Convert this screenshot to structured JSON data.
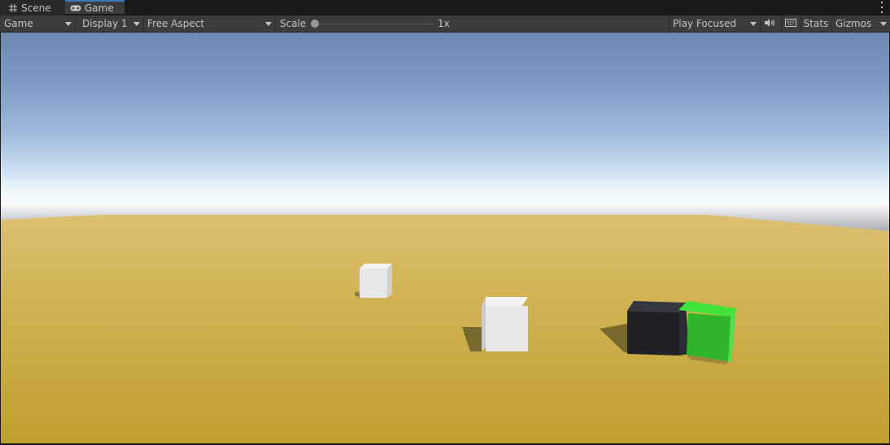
{
  "tabs": [
    {
      "label": "Scene",
      "icon": "grid-icon"
    },
    {
      "label": "Game",
      "icon": "gamepad-icon"
    }
  ],
  "toolbar": {
    "view_select": "Game",
    "display_select": "Display 1",
    "aspect_select": "Free Aspect",
    "scale_label": "Scale",
    "scale_value": "1x",
    "play_mode": "Play Focused",
    "audio_icon": "speaker-icon",
    "keyboard_icon": "keyboard-icon",
    "stats_label": "Stats",
    "gizmos_label": "Gizmos"
  },
  "colors": {
    "ground": "#c9a83a",
    "cube_white": "#e6e6e6",
    "cube_dark": "#1f2126",
    "cube_green": "#2fb52a",
    "tab_accent": "#3a79bb"
  }
}
